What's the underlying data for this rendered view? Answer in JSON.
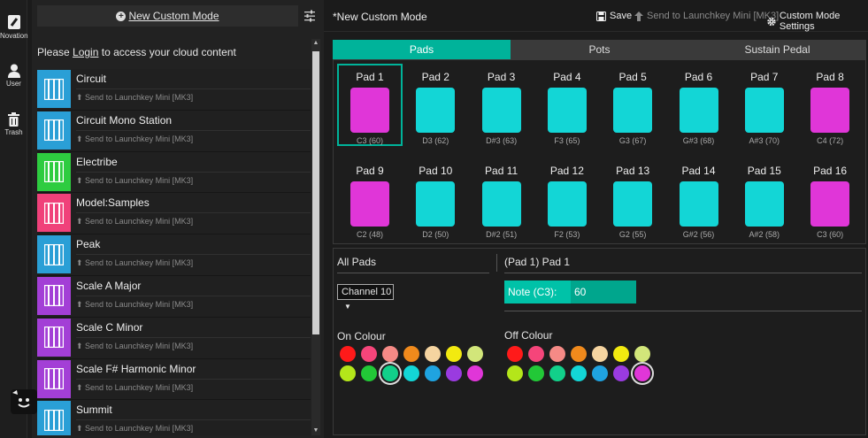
{
  "rail": {
    "items": [
      {
        "label": "Novation",
        "icon": "novation-logo-icon"
      },
      {
        "label": "User",
        "icon": "user-icon"
      },
      {
        "label": "Trash",
        "icon": "trash-icon"
      }
    ]
  },
  "library": {
    "new_mode_label": "New Custom Mode",
    "login_prefix": "Please ",
    "login_link": "Login",
    "login_suffix": " to access your cloud content",
    "modes": [
      {
        "name": "Circuit",
        "send": "Send to Launchkey Mini [MK3]",
        "color": "#2a9fd6"
      },
      {
        "name": "Circuit Mono Station",
        "send": "Send to Launchkey Mini [MK3]",
        "color": "#2a9fd6"
      },
      {
        "name": "Electribe",
        "send": "Send to Launchkey Mini [MK3]",
        "color": "#2ecc40"
      },
      {
        "name": "Model:Samples",
        "send": "Send to Launchkey Mini [MK3]",
        "color": "#f0417a"
      },
      {
        "name": "Peak",
        "send": "Send to Launchkey Mini [MK3]",
        "color": "#2a9fd6"
      },
      {
        "name": "Scale A Major",
        "send": "Send to Launchkey Mini [MK3]",
        "color": "#a33fd6"
      },
      {
        "name": "Scale C Minor",
        "send": "Send to Launchkey Mini [MK3]",
        "color": "#a33fd6"
      },
      {
        "name": "Scale F# Harmonic Minor",
        "send": "Send to Launchkey Mini [MK3]",
        "color": "#a33fd6"
      },
      {
        "name": "Summit",
        "send": "Send to Launchkey Mini [MK3]",
        "color": "#2a9fd6"
      }
    ]
  },
  "header": {
    "title": "*New Custom Mode",
    "save_label": "Save",
    "send_label": "Send to Launchkey Mini [MK3]",
    "settings_label": "Custom Mode Settings"
  },
  "tabs": [
    {
      "label": "Pads",
      "active": true
    },
    {
      "label": "Pots",
      "active": false
    },
    {
      "label": "Sustain Pedal",
      "active": false
    }
  ],
  "pads": [
    {
      "label": "Pad 1",
      "note": "C3 (60)",
      "color": "#e036d8",
      "selected": true
    },
    {
      "label": "Pad 2",
      "note": "D3 (62)",
      "color": "#13d6d6"
    },
    {
      "label": "Pad 3",
      "note": "D#3 (63)",
      "color": "#13d6d6"
    },
    {
      "label": "Pad 4",
      "note": "F3 (65)",
      "color": "#13d6d6"
    },
    {
      "label": "Pad 5",
      "note": "G3 (67)",
      "color": "#13d6d6"
    },
    {
      "label": "Pad 6",
      "note": "G#3 (68)",
      "color": "#13d6d6"
    },
    {
      "label": "Pad 7",
      "note": "A#3 (70)",
      "color": "#13d6d6"
    },
    {
      "label": "Pad 8",
      "note": "C4 (72)",
      "color": "#e036d8"
    },
    {
      "label": "Pad 9",
      "note": "C2 (48)",
      "color": "#e036d8"
    },
    {
      "label": "Pad 10",
      "note": "D2 (50)",
      "color": "#13d6d6"
    },
    {
      "label": "Pad 11",
      "note": "D#2 (51)",
      "color": "#13d6d6"
    },
    {
      "label": "Pad 12",
      "note": "F2 (53)",
      "color": "#13d6d6"
    },
    {
      "label": "Pad 13",
      "note": "G2 (55)",
      "color": "#13d6d6"
    },
    {
      "label": "Pad 14",
      "note": "G#2 (56)",
      "color": "#13d6d6"
    },
    {
      "label": "Pad 15",
      "note": "A#2 (58)",
      "color": "#13d6d6"
    },
    {
      "label": "Pad 16",
      "note": "C3 (60)",
      "color": "#e036d8"
    }
  ],
  "lower": {
    "all_pads_label": "All Pads",
    "channel": "Channel 10",
    "pad_title": "(Pad 1) Pad 1",
    "note_label": "Note (C3):",
    "note_value": "60",
    "on_colour_label": "On Colour",
    "off_colour_label": "Off Colour",
    "on_selected": 9,
    "off_selected": 13,
    "palette": [
      "#ff1a1a",
      "#f5457a",
      "#f58a86",
      "#f08a1c",
      "#f5d4a0",
      "#f2ea10",
      "#d2e67a",
      "#b4e61a",
      "#22c837",
      "#12d08a",
      "#13d6d6",
      "#1fa3e0",
      "#9a3be0",
      "#e036d8"
    ]
  }
}
